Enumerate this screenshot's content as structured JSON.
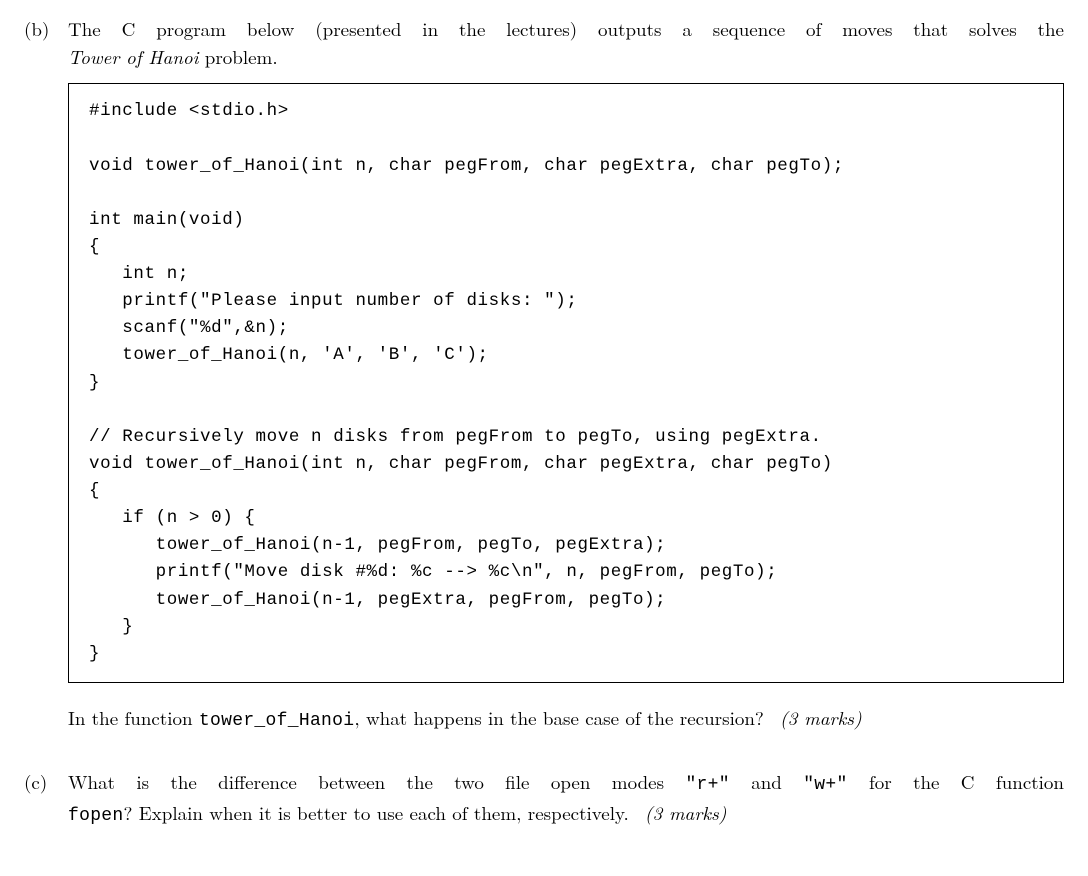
{
  "part_b": {
    "label": "(b)",
    "intro1_before_italic": "The C program below (presented in the lectures) outputs a sequence of moves that solves the",
    "intro2_italic": "Tower of Hanoi",
    "intro2_after": " problem.",
    "code": "#include <stdio.h>\n\nvoid tower_of_Hanoi(int n, char pegFrom, char pegExtra, char pegTo);\n\nint main(void)\n{\n   int n;\n   printf(\"Please input number of disks: \");\n   scanf(\"%d\",&n);\n   tower_of_Hanoi(n, 'A', 'B', 'C');\n}\n\n// Recursively move n disks from pegFrom to pegTo, using pegExtra.\nvoid tower_of_Hanoi(int n, char pegFrom, char pegExtra, char pegTo)\n{\n   if (n > 0) {\n      tower_of_Hanoi(n-1, pegFrom, pegTo, pegExtra);\n      printf(\"Move disk #%d: %c --> %c\\n\", n, pegFrom, pegTo);\n      tower_of_Hanoi(n-1, pegExtra, pegFrom, pegTo);\n   }\n}",
    "question_prefix": "In the function ",
    "question_code": "tower_of_Hanoi",
    "question_suffix": ", what happens in the base case of the recursion?",
    "marks": "(3 marks)"
  },
  "part_c": {
    "label": "(c)",
    "line1_seg1": "What is the difference between the two file open modes ",
    "line1_code1": "\"r+\"",
    "line1_seg2": " and ",
    "line1_code2": "\"w+\"",
    "line1_seg3": " for the C function",
    "line2_code": "fopen",
    "line2_text": "? Explain when it is better to use each of them, respectively.",
    "marks": "(3 marks)"
  }
}
